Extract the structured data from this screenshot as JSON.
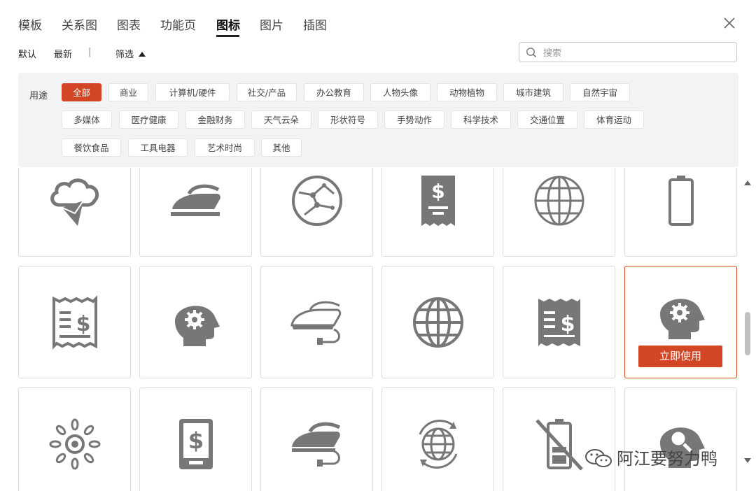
{
  "tabs": [
    {
      "label": "模板",
      "active": false
    },
    {
      "label": "关系图",
      "active": false
    },
    {
      "label": "图表",
      "active": false
    },
    {
      "label": "功能页",
      "active": false
    },
    {
      "label": "图标",
      "active": true
    },
    {
      "label": "图片",
      "active": false
    },
    {
      "label": "插图",
      "active": false
    }
  ],
  "sort": {
    "default": "默认",
    "newest": "最新",
    "divider": "|",
    "filter": "筛选"
  },
  "search": {
    "placeholder": "搜索",
    "value": ""
  },
  "filter": {
    "label": "用途",
    "tags": [
      "全部",
      "商业",
      "计算机/硬件",
      "社交/产品",
      "办公教育",
      "人物头像",
      "动物植物",
      "城市建筑",
      "自然宇宙",
      "多媒体",
      "医疗健康",
      "金融财务",
      "天气云朵",
      "形状符号",
      "手势动作",
      "科学技术",
      "交通位置",
      "体育运动",
      "餐饮食品",
      "工具电器",
      "艺术时尚",
      "其他"
    ],
    "active": "全部"
  },
  "icons": [
    {
      "name": "cloud-mail-icon"
    },
    {
      "name": "iron-icon"
    },
    {
      "name": "network-globe-icon"
    },
    {
      "name": "dollar-receipt-icon"
    },
    {
      "name": "globe-icon"
    },
    {
      "name": "battery-icon"
    },
    {
      "name": "receipt-dollar-icon"
    },
    {
      "name": "head-gear-icon"
    },
    {
      "name": "iron-outline-icon"
    },
    {
      "name": "globe-bold-icon"
    },
    {
      "name": "receipt-dollar-solid-icon"
    },
    {
      "name": "head-gear-solid-icon"
    },
    {
      "name": "sun-icon"
    },
    {
      "name": "mobile-dollar-icon"
    },
    {
      "name": "iron-plug-icon"
    },
    {
      "name": "globe-refresh-icon"
    },
    {
      "name": "battery-crossed-icon"
    },
    {
      "name": "head-search-icon"
    }
  ],
  "selected_card": {
    "use_button": "立即使用"
  },
  "watermark": "阿江要努力鸭",
  "colors": {
    "accent": "#d24625",
    "icon": "#777777"
  }
}
